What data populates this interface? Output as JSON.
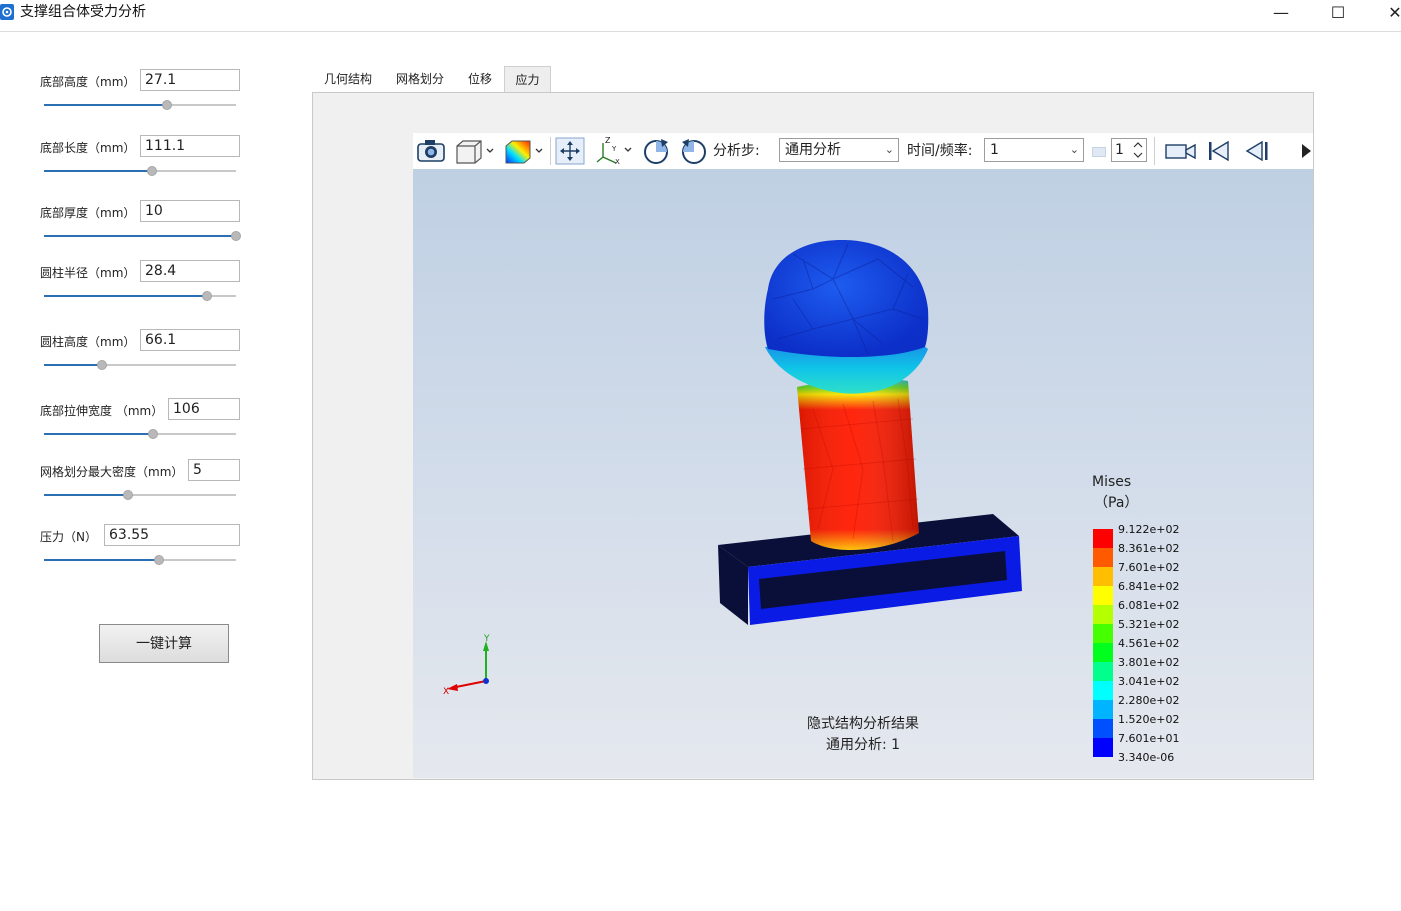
{
  "window": {
    "title": "支撑组合体受力分析",
    "minimize": "—",
    "maximize": "☐",
    "close": "✕"
  },
  "params": [
    {
      "label": "底部高度（mm）",
      "value": "27.1",
      "slider": 0.64
    },
    {
      "label": "底部长度（mm）",
      "value": "111.1",
      "slider": 0.56
    },
    {
      "label": "底部厚度（mm）",
      "value": "10",
      "slider": 1.0
    },
    {
      "label": "圆柱半径（mm）",
      "value": "28.4",
      "slider": 0.85
    },
    {
      "label": "圆柱高度（mm）",
      "value": "66.1",
      "slider": 0.3
    },
    {
      "label": "底部拉伸宽度 （mm）",
      "value": "106",
      "slider": 0.57
    },
    {
      "label": "网格划分最大密度（mm）",
      "value": "5",
      "slider": 0.44
    },
    {
      "label": "压力（N）",
      "value": "63.55",
      "slider": 0.6
    }
  ],
  "calc_button": "一键计算",
  "tabs": [
    "几何结构",
    "网格划分",
    "位移",
    "应力"
  ],
  "active_tab": 3,
  "toolbar": {
    "step_label": "分析步:",
    "step_value": "通用分析",
    "time_label": "时间/频率:",
    "time_value": "1",
    "frame_value": "1"
  },
  "viewport": {
    "result_title": "隐式结构分析结果",
    "result_sub": "通用分析: 1",
    "axis_x": "X",
    "axis_y": "Y"
  },
  "legend": {
    "title": "Mises",
    "unit": "（Pa）",
    "values": [
      "9.122e+02",
      "8.361e+02",
      "7.601e+02",
      "6.841e+02",
      "6.081e+02",
      "5.321e+02",
      "4.561e+02",
      "3.801e+02",
      "3.041e+02",
      "2.280e+02",
      "1.520e+02",
      "7.601e+01",
      "3.340e-06"
    ],
    "colors": [
      "#ff0000",
      "#ff5a00",
      "#ffbe00",
      "#ffff00",
      "#b4ff00",
      "#46ff00",
      "#00ff1e",
      "#00ff8c",
      "#00ffff",
      "#00b4ff",
      "#0050ff",
      "#0000ff"
    ]
  },
  "colors": {
    "accent": "#2c6fb3",
    "viewport_top": "#bfd0e3",
    "base_dark": "#0a0f3a",
    "base_blue": "#0b1be6"
  }
}
